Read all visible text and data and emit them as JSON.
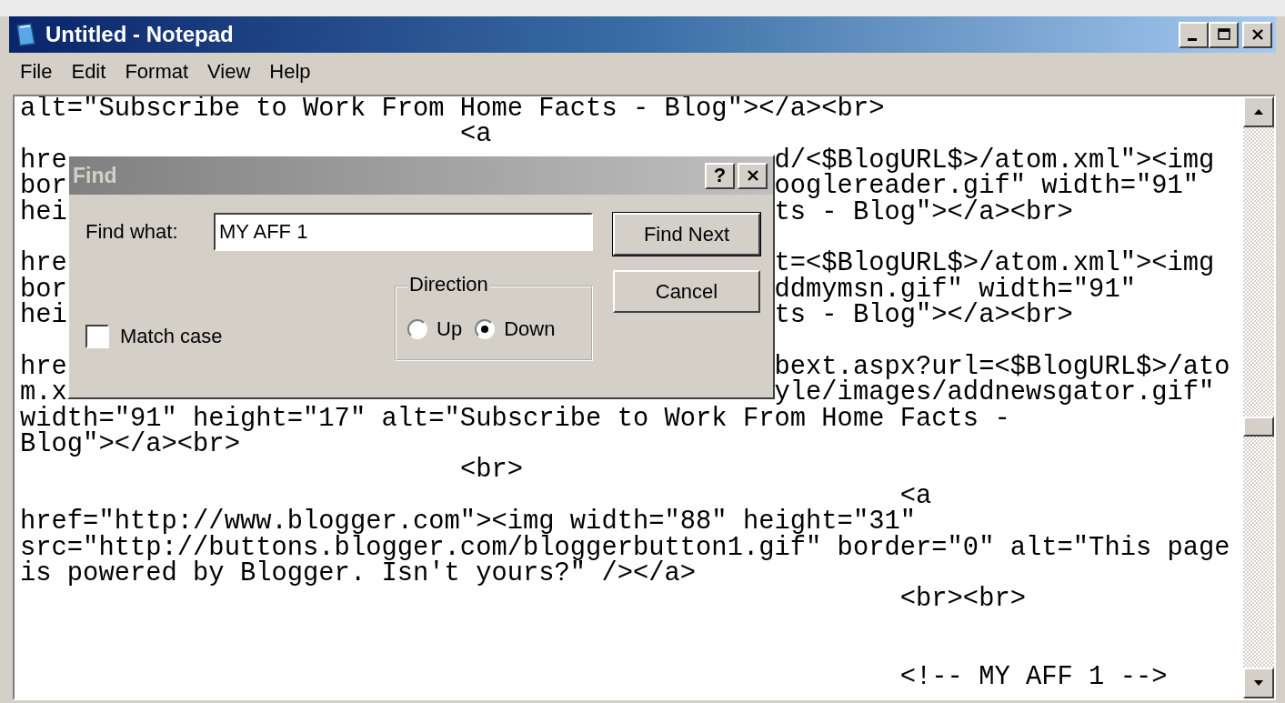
{
  "window": {
    "title": "Untitled - Notepad"
  },
  "menu": [
    "File",
    "Edit",
    "Format",
    "View",
    "Help"
  ],
  "editor": {
    "lines": [
      {
        "kind": "text",
        "text": "alt=\"Subscribe to Work From Home Facts - Blog\"></a><br>"
      },
      {
        "kind": "text",
        "text": "                            <a"
      },
      {
        "kind": "split",
        "left": "hre",
        "right": "d/<$BlogURL$>/atom.xml\"><img"
      },
      {
        "kind": "split",
        "left": "bor",
        "right": "ooglereader.gif\" width=\"91\""
      },
      {
        "kind": "split",
        "left": "hei",
        "right": "ts - Blog\"></a><br>"
      },
      {
        "kind": "blank"
      },
      {
        "kind": "split",
        "left": "hre",
        "right": "t=<$BlogURL$>/atom.xml\"><img"
      },
      {
        "kind": "split",
        "left": "bor",
        "right": "ddmymsn.gif\" width=\"91\""
      },
      {
        "kind": "split",
        "left": "hei",
        "right": "ts - Blog\"></a><br>"
      },
      {
        "kind": "blank"
      },
      {
        "kind": "split",
        "left": "hre",
        "right": "bext.aspx?url=<$BlogURL$>/ato"
      },
      {
        "kind": "split",
        "left": "m.x",
        "right": "yle/images/addnewsgator.gif\""
      },
      {
        "kind": "text",
        "text": "width=\"91\" height=\"17\" alt=\"Subscribe to Work From Home Facts -"
      },
      {
        "kind": "text",
        "text": "Blog\"></a><br>"
      },
      {
        "kind": "text",
        "text": "                            <br>"
      },
      {
        "kind": "text",
        "text": "                                                        <a"
      },
      {
        "kind": "text",
        "text": "href=\"http://www.blogger.com\"><img width=\"88\" height=\"31\""
      },
      {
        "kind": "text",
        "text": "src=\"http://buttons.blogger.com/bloggerbutton1.gif\" border=\"0\" alt=\"This page"
      },
      {
        "kind": "text",
        "text": "is powered by Blogger. Isn't yours?\" /></a>"
      },
      {
        "kind": "text",
        "text": "                                                        <br><br>"
      },
      {
        "kind": "blank"
      },
      {
        "kind": "blank"
      },
      {
        "kind": "text",
        "text": "                                                        <!-- MY AFF 1 -->"
      }
    ]
  },
  "find_dialog": {
    "title": "Find",
    "help": "?",
    "find_what": {
      "label": "Find what:",
      "value": "MY AFF 1"
    },
    "buttons": [
      {
        "label": "Find Next",
        "default": true
      },
      {
        "label": "Cancel",
        "default": false
      }
    ],
    "match_case": {
      "label": "Match case",
      "checked": false
    },
    "direction": {
      "label": "Direction",
      "options": [
        {
          "label": "Up",
          "selected": false
        },
        {
          "label": "Down",
          "selected": true
        }
      ]
    }
  }
}
